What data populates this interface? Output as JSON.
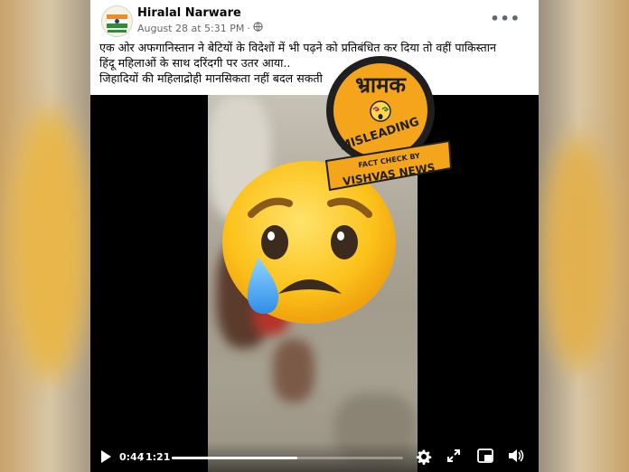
{
  "post": {
    "author": "Hiralal Narware",
    "date": "August 28 at 5:31 PM",
    "separator": "·",
    "more_label": "•••",
    "text_lines": [
      "एक ओर अफगानिस्तान ने बेटियों के विदेशों में भी पढ़ने को प्रतिबंधित कर दिया तो वहीं पाकिस्तान",
      "हिंदू महिलाओं के साथ दरिंदगी पर उतर आया..",
      "जिहादियों की महिलाद्रोही मानसिकता नहीं बदल सकती"
    ]
  },
  "video": {
    "current_time": "0:44",
    "time_separator": "/",
    "total_time": "1:21",
    "progress": 0.543
  },
  "badge": {
    "word": "भ्रामक",
    "rating": "MISLEADING",
    "ribbon_line1": "FACT CHECK BY",
    "ribbon_line2": "VISHVAS NEWS"
  },
  "colors": {
    "badge_orange": "#f4a51c",
    "badge_dark": "#1f1f1f",
    "emoji_yellow": "#fcc21b",
    "tear_blue": "#40a8f5"
  },
  "icons": [
    "play-icon",
    "settings-icon",
    "expand-icon",
    "miniplayer-icon",
    "volume-icon",
    "globe-icon",
    "sad-tear-emoji-icon"
  ]
}
